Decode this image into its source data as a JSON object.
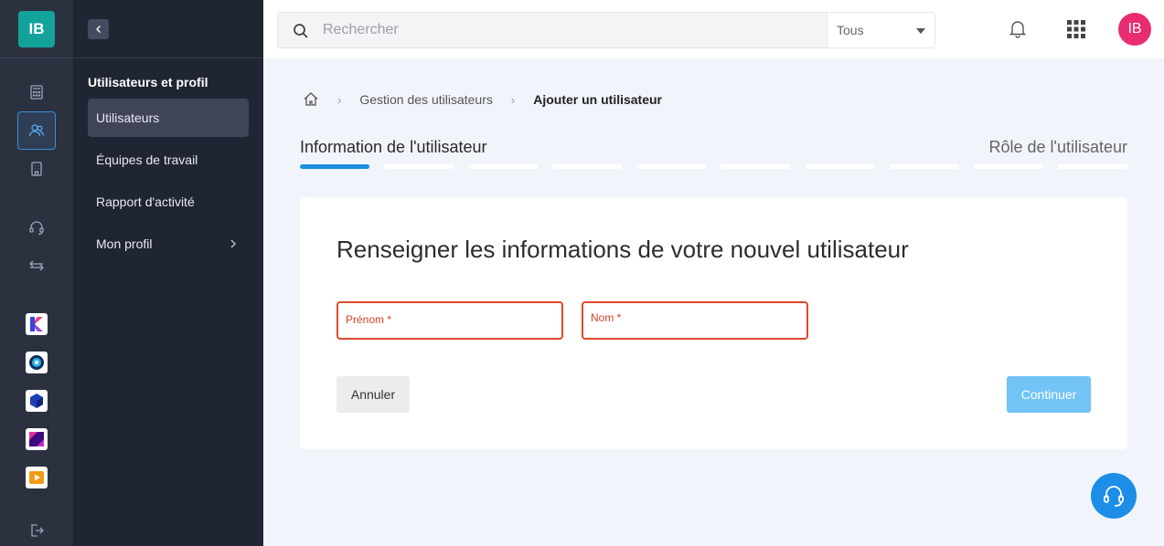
{
  "rail": {
    "logo": "IB",
    "icons": [
      "calculator-icon",
      "users-icon",
      "building-icon",
      "headset-icon",
      "transfer-icon",
      "logout-icon"
    ],
    "apps": [
      "app-k-icon",
      "app-disc-icon",
      "app-cube-icon",
      "app-square-icon",
      "app-play-icon"
    ]
  },
  "subnav": {
    "title": "Utilisateurs et profil",
    "items": [
      {
        "label": "Utilisateurs"
      },
      {
        "label": "Équipes de travail"
      },
      {
        "label": "Rapport d'activité"
      },
      {
        "label": "Mon profil"
      }
    ]
  },
  "topbar": {
    "search_placeholder": "Rechercher",
    "search_scope": "Tous",
    "avatar": "IB"
  },
  "breadcrumb": {
    "parent": "Gestion des utilisateurs",
    "current": "Ajouter un utilisateur"
  },
  "stepper": {
    "left_label": "Information de l'utilisateur",
    "right_label": "Rôle de l'utilisateur",
    "total_segments": 10,
    "completed_segments": 1
  },
  "form": {
    "title": "Renseigner les informations de votre nouvel utilisateur",
    "first_name_label": "Prénom *",
    "last_name_label": "Nom *",
    "cancel_label": "Annuler",
    "continue_label": "Continuer"
  },
  "colors": {
    "accent": "#1a8fe0",
    "error": "#e0492c",
    "brand": "#13a39a",
    "avatar": "#e92b72"
  }
}
